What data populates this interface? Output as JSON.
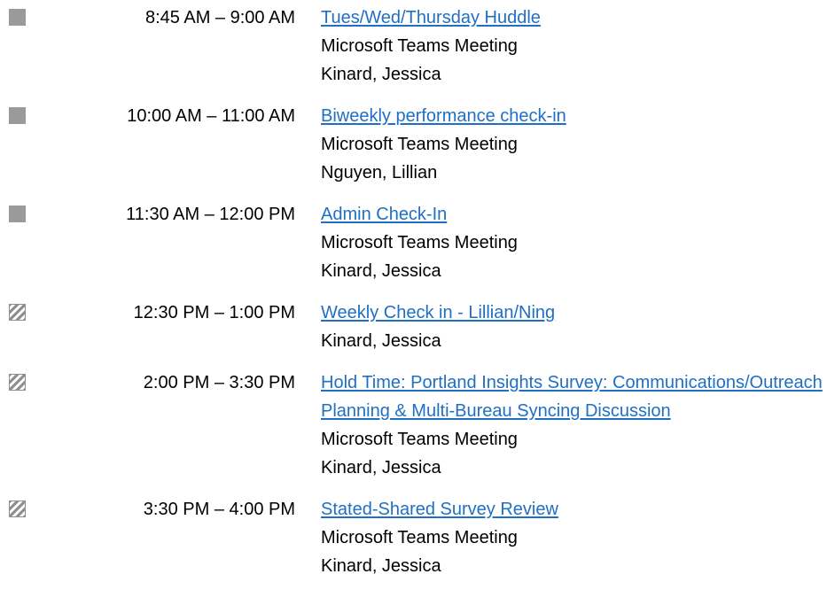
{
  "events": [
    {
      "status_icon": "busy-square-icon",
      "time": "8:45 AM – 9:00 AM",
      "title": "Tues/Wed/Thursday Huddle",
      "location": "Microsoft Teams Meeting",
      "organizer": "Kinard, Jessica"
    },
    {
      "status_icon": "busy-square-icon",
      "time": "10:00 AM – 11:00 AM",
      "title": "Biweekly performance check-in",
      "location": "Microsoft Teams Meeting",
      "organizer": "Nguyen, Lillian"
    },
    {
      "status_icon": "busy-square-icon",
      "time": "11:30 AM – 12:00 PM",
      "title": "Admin Check-In",
      "location": "Microsoft Teams Meeting",
      "organizer": "Kinard, Jessica"
    },
    {
      "status_icon": "tentative-hatched-icon",
      "time": "12:30 PM – 1:00 PM",
      "title": "Weekly Check in - Lillian/Ning",
      "organizer": "Kinard, Jessica"
    },
    {
      "status_icon": "tentative-hatched-icon",
      "time": "2:00 PM – 3:30 PM",
      "title": "Hold Time: Portland Insights Survey: Communications/Outreach Planning & Multi-Bureau Syncing Discussion",
      "location": "Microsoft Teams Meeting",
      "organizer": "Kinard, Jessica"
    },
    {
      "status_icon": "tentative-hatched-icon",
      "time": "3:30 PM – 4:00 PM",
      "title": "Stated-Shared Survey Review",
      "location": "Microsoft Teams Meeting",
      "organizer": "Kinard, Jessica"
    }
  ],
  "colors": {
    "link": "#1f6fc4",
    "busy": "#9a9a9a",
    "tentative": "#8f8f8f"
  }
}
